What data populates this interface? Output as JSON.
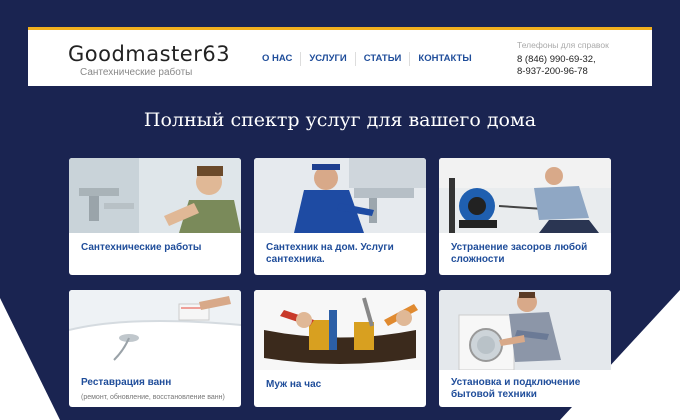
{
  "brand": {
    "logo": "Goodmaster63",
    "tagline": "Сантехнические работы"
  },
  "nav": [
    "О НАС",
    "УСЛУГИ",
    "СТАТЬИ",
    "КОНТАКТЫ"
  ],
  "phones": {
    "label": "Телефоны для справок",
    "phone1": "8 (846) 990-69-32,",
    "phone2": "8-937-200-96-78"
  },
  "hero": {
    "title": "Полный спектр услуг для вашего дома"
  },
  "cards": [
    {
      "title": "Сантехнические работы",
      "image": "plumber-under-sink"
    },
    {
      "title": "Сантехник на дом. Услуги сантехника.",
      "image": "plumber-in-uniform"
    },
    {
      "title": "Устранение засоров любой сложности",
      "image": "drain-cleaning-machine"
    },
    {
      "title": "Реставрация ванн",
      "subtitle": "(ремонт, обновление, восстановление ванн)",
      "image": "bathtub-restoration"
    },
    {
      "title": "Муж на час",
      "image": "tool-belt"
    },
    {
      "title": "Установка и подключение бытовой техники",
      "image": "washing-machine-install"
    }
  ],
  "colors": {
    "background": "#1a2451",
    "accent": "#f2b01e",
    "link": "#1f4d9a"
  }
}
